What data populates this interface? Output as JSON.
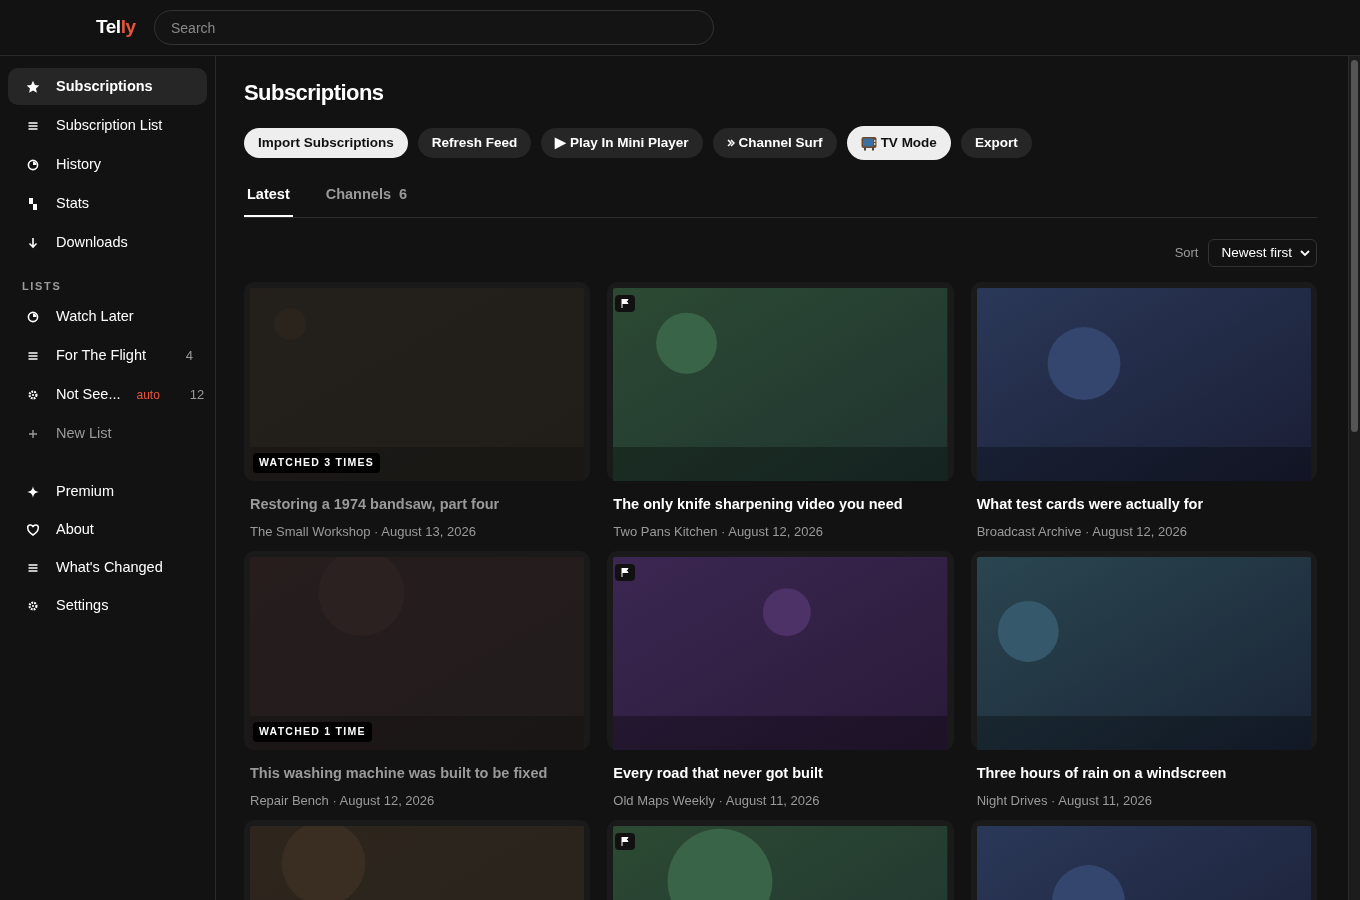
{
  "header": {
    "logo_main": "Tel",
    "logo_accent": "ly",
    "search": {
      "placeholder": "Search"
    }
  },
  "sidebar": {
    "items": [
      {
        "label": "Subscriptions",
        "selected": true
      },
      {
        "label": "Subscription List",
        "selected": false
      },
      {
        "label": "History",
        "selected": false
      },
      {
        "label": "Stats",
        "selected": false
      },
      {
        "label": "Downloads",
        "selected": false
      }
    ],
    "lists_heading": "LISTS",
    "lists": [
      {
        "label": "Watch Later",
        "kind": "list"
      },
      {
        "label": "For The Flight",
        "count": "4",
        "kind": "list"
      },
      {
        "label": "Not See...",
        "tag": "auto",
        "count": "12",
        "kind": "list"
      },
      {
        "label": "New List",
        "kind": "add"
      }
    ],
    "footer_items": [
      {
        "label": "Premium"
      },
      {
        "label": "About"
      },
      {
        "label": "What's Changed"
      },
      {
        "label": "Settings"
      }
    ]
  },
  "page": {
    "title": "Subscriptions",
    "actions": [
      {
        "label": "Import Subscriptions",
        "highlighted": true
      },
      {
        "label": "Refresh Feed",
        "highlighted": false
      },
      {
        "label": "▶ Play In Mini Player",
        "highlighted": false
      },
      {
        "label": "Channel Surf",
        "highlighted": false
      },
      {
        "label": "TV Mode",
        "highlighted": true
      },
      {
        "label": "Export",
        "highlighted": false
      }
    ],
    "tabs": [
      {
        "label": "Latest",
        "selected": true
      },
      {
        "label": "Channels",
        "count": "6",
        "selected": false
      }
    ],
    "sort": {
      "label": "Sort",
      "value": "Newest first"
    },
    "videos": [
      {
        "title": "Restoring a 1974 bandsaw, part four",
        "meta": "The Small Workshop · August 13, 2026",
        "watched": true,
        "watched_label": "WATCHED 3 TIMES",
        "flagged": false
      },
      {
        "title": "The only knife sharpening video you need",
        "meta": "Two Pans Kitchen · August 12, 2026",
        "watched": false,
        "flagged": true
      },
      {
        "title": "What test cards were actually for",
        "meta": "Broadcast Archive · August 12, 2026",
        "watched": false,
        "flagged": false
      },
      {
        "title": "This washing machine was built to be fixed",
        "meta": "Repair Bench · August 12, 2026",
        "watched": true,
        "watched_label": "WATCHED 1 TIME",
        "flagged": false
      },
      {
        "title": "Every road that never got built",
        "meta": "Old Maps Weekly · August 11, 2026",
        "watched": false,
        "flagged": true
      },
      {
        "title": "Three hours of rain on a windscreen",
        "meta": "Night Drives · August 11, 2026",
        "watched": false,
        "flagged": false
      },
      {
        "watched": false,
        "flagged": false
      },
      {
        "watched": false,
        "flagged": true
      },
      {
        "watched": false,
        "flagged": false
      }
    ]
  }
}
